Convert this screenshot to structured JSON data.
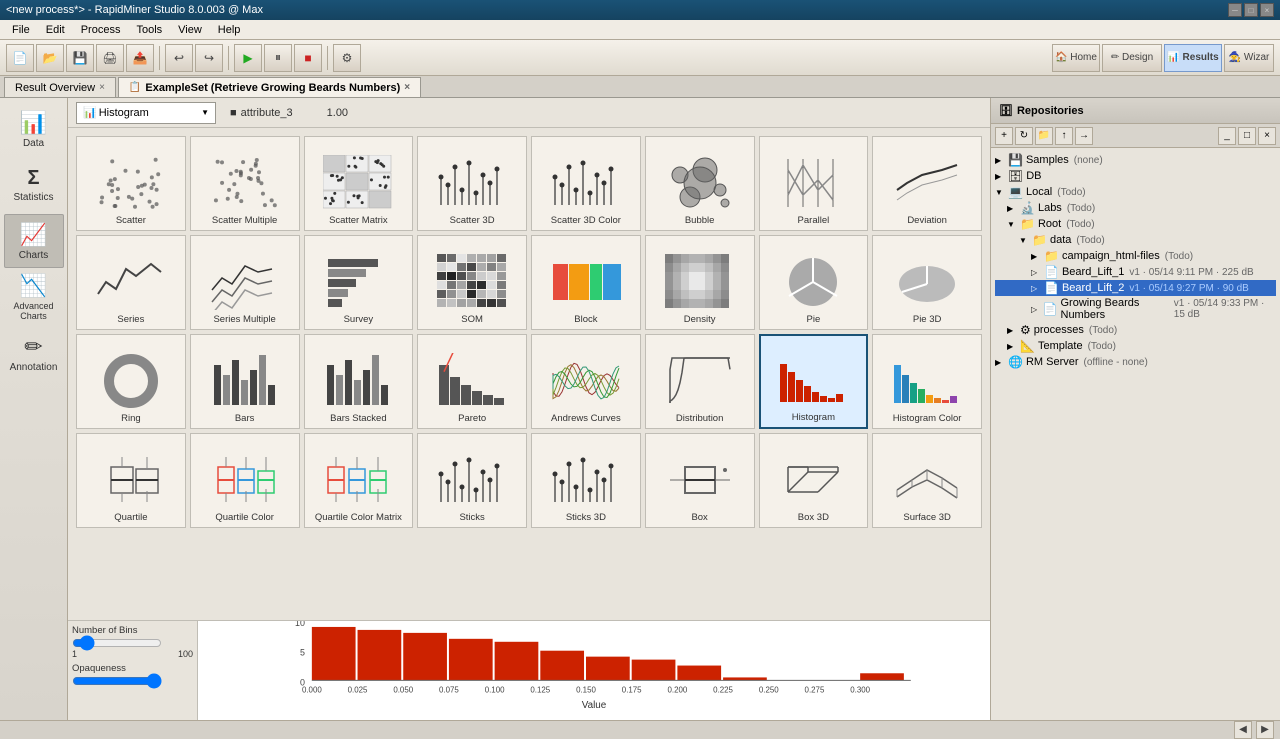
{
  "titleBar": {
    "text": "<new process*> - RapidMiner Studio 8.0.003 @ Max",
    "btns": [
      "─",
      "□",
      "×"
    ]
  },
  "menuBar": {
    "items": [
      "File",
      "Edit",
      "Process",
      "Tools",
      "View",
      "Help"
    ]
  },
  "tabs": [
    {
      "label": "Result Overview",
      "active": false,
      "closable": true
    },
    {
      "label": "ExampleSet (Retrieve Growing Beards Numbers)",
      "active": true,
      "closable": true
    }
  ],
  "sidebar": {
    "items": [
      {
        "icon": "📊",
        "label": "Data"
      },
      {
        "icon": "Σ",
        "label": "Statistics"
      },
      {
        "icon": "📈",
        "label": "Charts"
      },
      {
        "icon": "📉",
        "label": "Advanced Charts"
      },
      {
        "icon": "✏",
        "label": "Annotation"
      }
    ]
  },
  "chartToolbar": {
    "dropdownLabel": "Histogram",
    "dropdownIcon": "📊",
    "attributeLabel": "attribute_3",
    "value": "1.00"
  },
  "charts": [
    {
      "id": "scatter",
      "label": "Scatter",
      "selected": false
    },
    {
      "id": "scatter-multiple",
      "label": "Scatter Multiple",
      "selected": false
    },
    {
      "id": "scatter-matrix",
      "label": "Scatter Matrix",
      "selected": false
    },
    {
      "id": "scatter-3d",
      "label": "Scatter 3D",
      "selected": false
    },
    {
      "id": "scatter-3d-color",
      "label": "Scatter 3D Color",
      "selected": false
    },
    {
      "id": "bubble",
      "label": "Bubble",
      "selected": false
    },
    {
      "id": "parallel",
      "label": "Parallel",
      "selected": false
    },
    {
      "id": "deviation",
      "label": "Deviation",
      "selected": false
    },
    {
      "id": "series",
      "label": "Series",
      "selected": false
    },
    {
      "id": "series-multiple",
      "label": "Series Multiple",
      "selected": false
    },
    {
      "id": "survey",
      "label": "Survey",
      "selected": false
    },
    {
      "id": "som",
      "label": "SOM",
      "selected": false
    },
    {
      "id": "block",
      "label": "Block",
      "selected": false
    },
    {
      "id": "density",
      "label": "Density",
      "selected": false
    },
    {
      "id": "pie",
      "label": "Pie",
      "selected": false
    },
    {
      "id": "pie-3d",
      "label": "Pie 3D",
      "selected": false
    },
    {
      "id": "ring",
      "label": "Ring",
      "selected": false
    },
    {
      "id": "bars",
      "label": "Bars",
      "selected": false
    },
    {
      "id": "bars-stacked",
      "label": "Bars Stacked",
      "selected": false
    },
    {
      "id": "pareto",
      "label": "Pareto",
      "selected": false
    },
    {
      "id": "andrews-curves",
      "label": "Andrews Curves",
      "selected": false
    },
    {
      "id": "distribution",
      "label": "Distribution",
      "selected": false
    },
    {
      "id": "histogram",
      "label": "Histogram",
      "selected": true
    },
    {
      "id": "histogram-color",
      "label": "Histogram Color",
      "selected": false
    },
    {
      "id": "quartile",
      "label": "Quartile",
      "selected": false
    },
    {
      "id": "quartile-color",
      "label": "Quartile Color",
      "selected": false
    },
    {
      "id": "quartile-color-matrix",
      "label": "Quartile Color Matrix",
      "selected": false
    },
    {
      "id": "sticks",
      "label": "Sticks",
      "selected": false
    },
    {
      "id": "sticks-3d",
      "label": "Sticks 3D",
      "selected": false
    },
    {
      "id": "box",
      "label": "Box",
      "selected": false
    },
    {
      "id": "box-3d",
      "label": "Box 3D",
      "selected": false
    },
    {
      "id": "surface-3d",
      "label": "Surface 3D",
      "selected": false
    }
  ],
  "rightPanel": {
    "title": "Repositories",
    "tree": [
      {
        "level": 0,
        "arrow": "▶",
        "icon": "💾",
        "label": "Samples",
        "meta": "(none)"
      },
      {
        "level": 0,
        "arrow": "▶",
        "icon": "🗄",
        "label": "DB",
        "meta": ""
      },
      {
        "level": 0,
        "arrow": "▼",
        "icon": "💻",
        "label": "Local",
        "meta": "(Todo)"
      },
      {
        "level": 1,
        "arrow": "▶",
        "icon": "🔬",
        "label": "Labs",
        "meta": "(Todo)"
      },
      {
        "level": 1,
        "arrow": "▼",
        "icon": "📁",
        "label": "Root",
        "meta": "(Todo)"
      },
      {
        "level": 2,
        "arrow": "▼",
        "icon": "📁",
        "label": "data",
        "meta": "(Todo)"
      },
      {
        "level": 3,
        "arrow": "▶",
        "icon": "📁",
        "label": "campaign_html-files",
        "meta": "(Todo)"
      },
      {
        "level": 3,
        "arrow": "▷",
        "icon": "📄",
        "label": "Beard_Lift_1",
        "meta": "v1 · 05/14 9:11 PM · 225 dB"
      },
      {
        "level": 3,
        "arrow": "▷",
        "icon": "📄",
        "label": "Beard_Lift_2",
        "meta": "v1 · 05/14 9:27 PM · 90 dB",
        "highlighted": true
      },
      {
        "level": 3,
        "arrow": "▷",
        "icon": "📄",
        "label": "Growing Beards Numbers",
        "meta": "v1 · 05/14 9:33 PM · 15 dB"
      },
      {
        "level": 1,
        "arrow": "▶",
        "icon": "⚙",
        "label": "processes",
        "meta": "(Todo)"
      },
      {
        "level": 1,
        "arrow": "▶",
        "icon": "📐",
        "label": "Template",
        "meta": "(Todo)"
      },
      {
        "level": 0,
        "arrow": "▶",
        "icon": "🌐",
        "label": "RM Server",
        "meta": "(offline - none)"
      }
    ]
  },
  "bottomChart": {
    "xLabel": "Value",
    "xTicks": [
      "0.000",
      "0.025",
      "0.050",
      "0.075",
      "0.100",
      "0.125",
      "0.150",
      "0.175",
      "0.200",
      "0.225",
      "0.250",
      "0.275",
      "0.300"
    ],
    "yTicks": [
      "0",
      "5",
      "10"
    ],
    "controls": {
      "label": "Number of Bins",
      "min": 1,
      "max": 100,
      "value": 10,
      "opacityLabel": "Opaqueness"
    },
    "bars": [
      {
        "x": 0,
        "h": 0.9
      },
      {
        "x": 1,
        "h": 0.85
      },
      {
        "x": 2,
        "h": 0.8
      },
      {
        "x": 3,
        "h": 0.7
      },
      {
        "x": 4,
        "h": 0.65
      },
      {
        "x": 5,
        "h": 0.5
      },
      {
        "x": 6,
        "h": 0.4
      },
      {
        "x": 7,
        "h": 0.35
      },
      {
        "x": 8,
        "h": 0.25
      },
      {
        "x": 9,
        "h": 0.05
      },
      {
        "x": 10,
        "h": 0.0
      },
      {
        "x": 11,
        "h": 0.0
      },
      {
        "x": 12,
        "h": 0.12
      }
    ]
  },
  "statusBar": {
    "text": ""
  }
}
